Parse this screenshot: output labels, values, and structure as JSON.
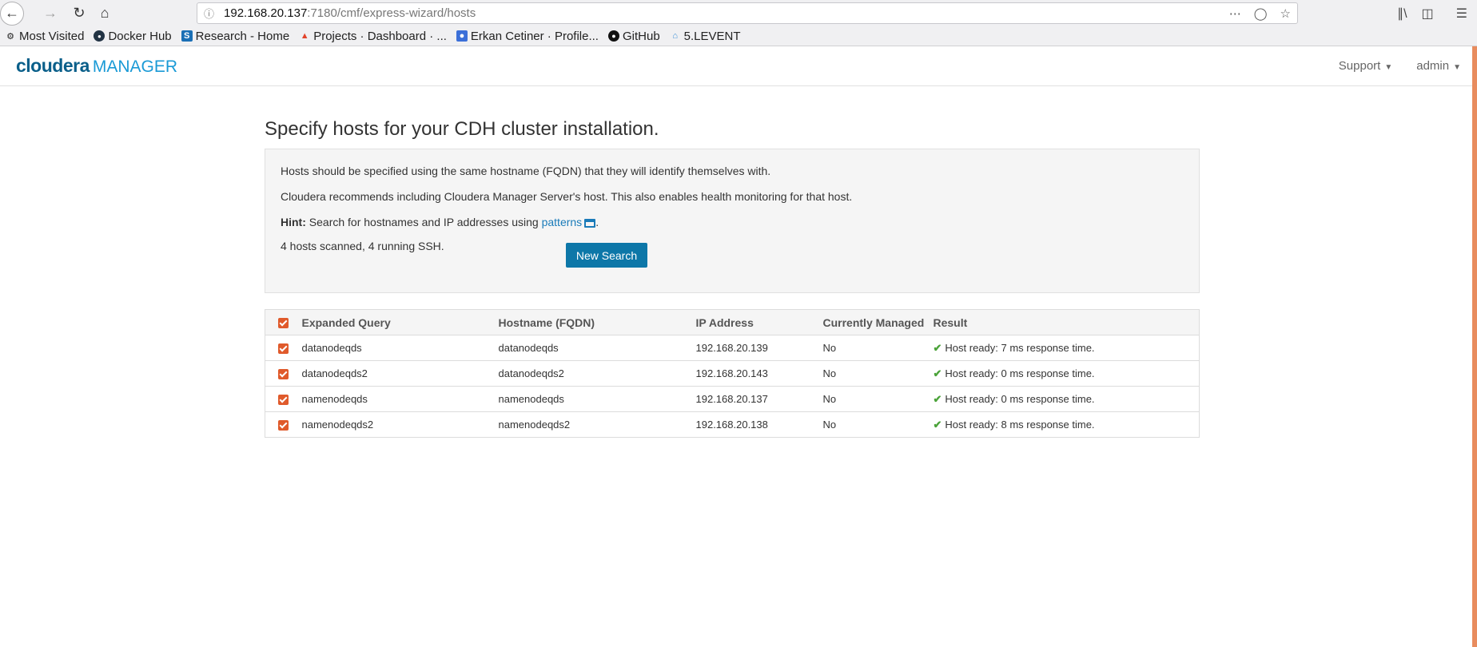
{
  "browser": {
    "url_host": "192.168.20.137",
    "url_path": ":7180/cmf/express-wizard/hosts",
    "bookmarks": [
      {
        "label": "Most Visited",
        "icon": "gear-icon"
      },
      {
        "label": "Docker Hub",
        "icon": "docker-icon"
      },
      {
        "label": "Research - Home",
        "icon": "sharepoint-icon"
      },
      {
        "label": "Projects · Dashboard · ...",
        "icon": "gitlab-icon"
      },
      {
        "label": "Erkan Cetiner · Profile...",
        "icon": "profile-icon"
      },
      {
        "label": "GitHub",
        "icon": "github-icon"
      },
      {
        "label": "5.LEVENT",
        "icon": "home-icon"
      }
    ]
  },
  "header": {
    "logo_brand": "cloudera",
    "logo_product": "MANAGER",
    "support_label": "Support",
    "admin_label": "admin"
  },
  "main": {
    "title": "Specify hosts for your CDH cluster installation.",
    "info_line1": "Hosts should be specified using the same hostname (FQDN) that they will identify themselves with.",
    "info_line2": "Cloudera recommends including Cloudera Manager Server's host. This also enables health monitoring for that host.",
    "hint_label": "Hint:",
    "hint_text": " Search for hostnames and IP addresses using ",
    "hint_link": "patterns",
    "scan_status": "4 hosts scanned, 4 running SSH.",
    "new_search_label": "New Search"
  },
  "table": {
    "headers": [
      "Expanded Query",
      "Hostname (FQDN)",
      "IP Address",
      "Currently Managed",
      "Result"
    ],
    "rows": [
      {
        "query": "datanodeqds",
        "hostname": "datanodeqds",
        "ip": "192.168.20.139",
        "managed": "No",
        "result": "Host ready: 7 ms response time."
      },
      {
        "query": "datanodeqds2",
        "hostname": "datanodeqds2",
        "ip": "192.168.20.143",
        "managed": "No",
        "result": "Host ready: 0 ms response time."
      },
      {
        "query": "namenodeqds",
        "hostname": "namenodeqds",
        "ip": "192.168.20.137",
        "managed": "No",
        "result": "Host ready: 0 ms response time."
      },
      {
        "query": "namenodeqds2",
        "hostname": "namenodeqds2",
        "ip": "192.168.20.138",
        "managed": "No",
        "result": "Host ready: 8 ms response time."
      }
    ]
  },
  "colors": {
    "accent": "#0d77a8",
    "checkbox": "#e05a2b",
    "success": "#4ba33a"
  }
}
